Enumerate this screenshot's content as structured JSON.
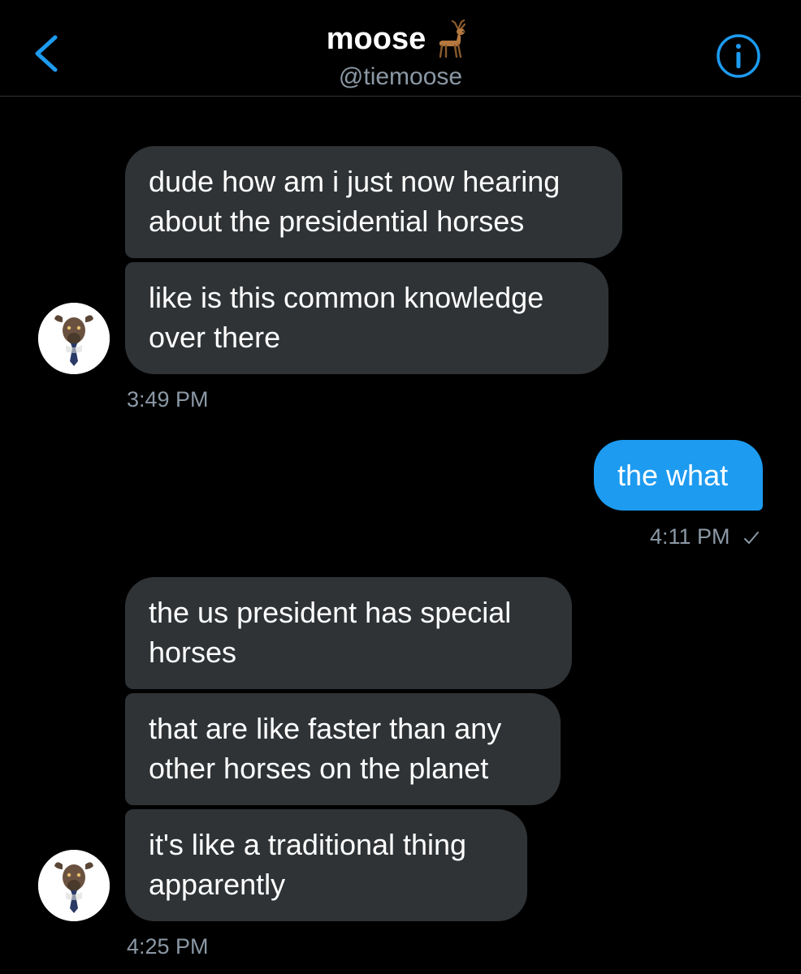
{
  "header": {
    "name": "moose",
    "handle": "@tiemoose",
    "back_icon": "chevron-left-icon",
    "info_icon": "info-icon",
    "name_emoji_icon": "deer-emoji-icon",
    "accent_color": "#1d9bf0"
  },
  "messages": {
    "group1": {
      "m1_line1": "dude how am i just now hearing",
      "m1_line2": "about the presidential horses",
      "m2_line1": "like is this common knowledge",
      "m2_line2": "over there",
      "time": "3:49 PM"
    },
    "sent": {
      "text": "the what",
      "time": "4:11 PM",
      "status_icon": "checkmark-icon"
    },
    "group2": {
      "m1_line1": "the us president has special",
      "m1_line2": "horses",
      "m2_line1": "that are like faster than any",
      "m2_line2": "other horses on the planet",
      "m3_line1": "it's like a traditional thing",
      "m3_line2": "apparently",
      "time": "4:25 PM"
    }
  }
}
